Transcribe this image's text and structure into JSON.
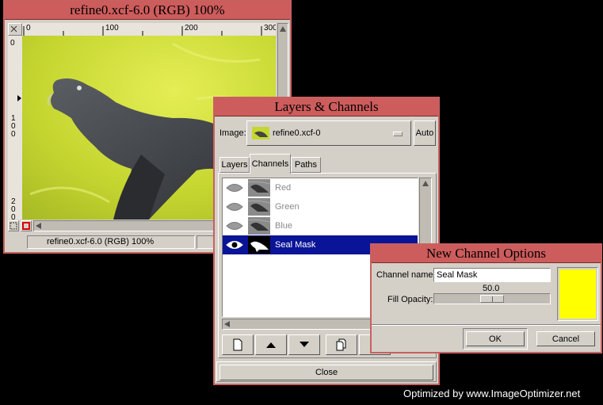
{
  "image_window": {
    "title": "refine0.xcf-6.0 (RGB) 100%",
    "status": "refine0.xcf-6.0 (RGB) 100%",
    "hruler": [
      "0",
      "100",
      "200",
      "300"
    ],
    "vruler": [
      "0",
      "1 0 0",
      "2 0 0"
    ]
  },
  "layers_dialog": {
    "title": "Layers & Channels",
    "image_label": "Image:",
    "image_value": "refine0.xcf-0",
    "auto_label": "Auto",
    "tabs": [
      "Layers",
      "Channels",
      "Paths"
    ],
    "active_tab": "Channels",
    "channels": [
      {
        "name": "Red",
        "selected": false
      },
      {
        "name": "Green",
        "selected": false
      },
      {
        "name": "Blue",
        "selected": false
      },
      {
        "name": "Seal Mask",
        "selected": true
      }
    ],
    "close_label": "Close"
  },
  "channel_options": {
    "title": "New Channel Options",
    "name_label": "Channel name:",
    "name_value": "Seal Mask",
    "opacity_label": "Fill Opacity:",
    "opacity_value": "50.0",
    "opacity_fraction": 0.5,
    "color": "#ffff00",
    "ok_label": "OK",
    "cancel_label": "Cancel"
  },
  "watermark": "Optimized by www.ImageOptimizer.net"
}
